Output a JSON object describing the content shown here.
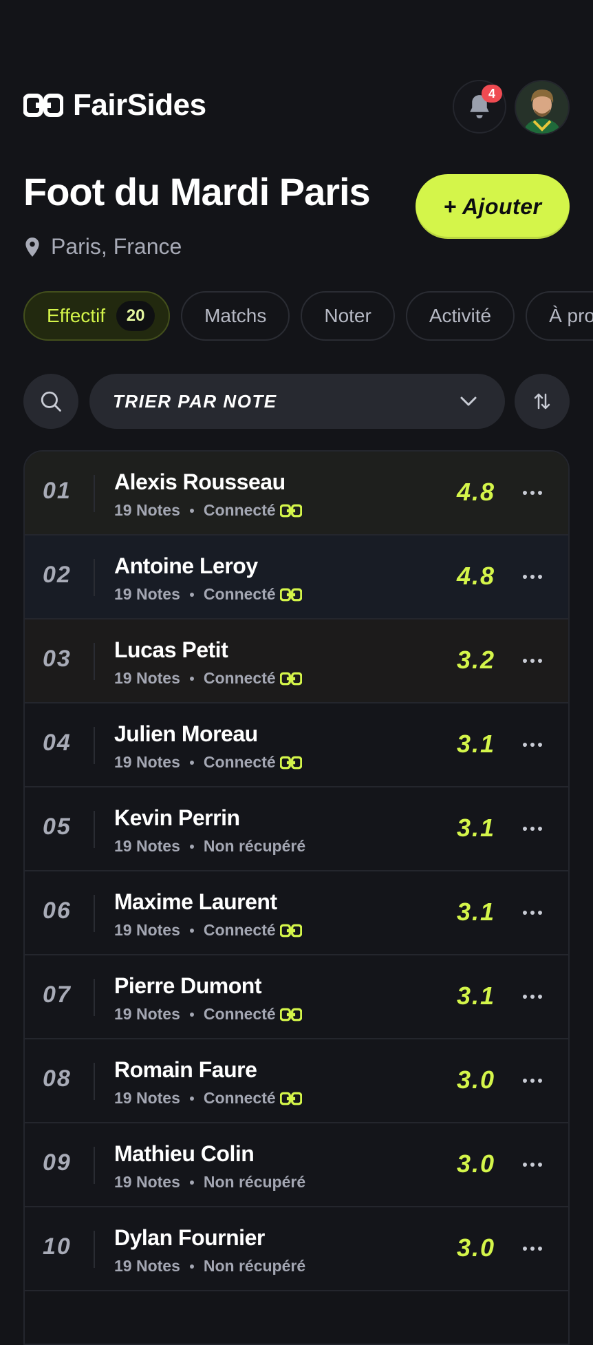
{
  "header": {
    "app_name": "FairSides",
    "notification_count": "4"
  },
  "page": {
    "title": "Foot du Mardi Paris",
    "location": "Paris, France",
    "add_button_label": "+ Ajouter"
  },
  "tabs": [
    {
      "label": "Effectif",
      "count": "20",
      "active": true
    },
    {
      "label": "Matchs"
    },
    {
      "label": "Noter"
    },
    {
      "label": "Activité"
    },
    {
      "label": "À propos"
    }
  ],
  "toolbar": {
    "sort_label": "TRIER PAR NOTE"
  },
  "players": [
    {
      "rank": "01",
      "name": "Alexis Rousseau",
      "notes": "19 Notes",
      "status": "Connecté",
      "connected": true,
      "score": "4.8"
    },
    {
      "rank": "02",
      "name": "Antoine Leroy",
      "notes": "19 Notes",
      "status": "Connecté",
      "connected": true,
      "score": "4.8"
    },
    {
      "rank": "03",
      "name": "Lucas Petit",
      "notes": "19 Notes",
      "status": "Connecté",
      "connected": true,
      "score": "3.2"
    },
    {
      "rank": "04",
      "name": "Julien Moreau",
      "notes": "19 Notes",
      "status": "Connecté",
      "connected": true,
      "score": "3.1"
    },
    {
      "rank": "05",
      "name": "Kevin Perrin",
      "notes": "19 Notes",
      "status": "Non récupéré",
      "connected": false,
      "score": "3.1"
    },
    {
      "rank": "06",
      "name": "Maxime Laurent",
      "notes": "19 Notes",
      "status": "Connecté",
      "connected": true,
      "score": "3.1"
    },
    {
      "rank": "07",
      "name": "Pierre Dumont",
      "notes": "19 Notes",
      "status": "Connecté",
      "connected": true,
      "score": "3.1"
    },
    {
      "rank": "08",
      "name": "Romain Faure",
      "notes": "19 Notes",
      "status": "Connecté",
      "connected": true,
      "score": "3.0"
    },
    {
      "rank": "09",
      "name": "Mathieu Colin",
      "notes": "19 Notes",
      "status": "Non récupéré",
      "connected": false,
      "score": "3.0"
    },
    {
      "rank": "10",
      "name": "Dylan Fournier",
      "notes": "19 Notes",
      "status": "Non récupéré",
      "connected": false,
      "score": "3.0"
    }
  ],
  "colors": {
    "accent": "#d4f54a",
    "background": "#131418",
    "badge": "#ef4b52"
  }
}
